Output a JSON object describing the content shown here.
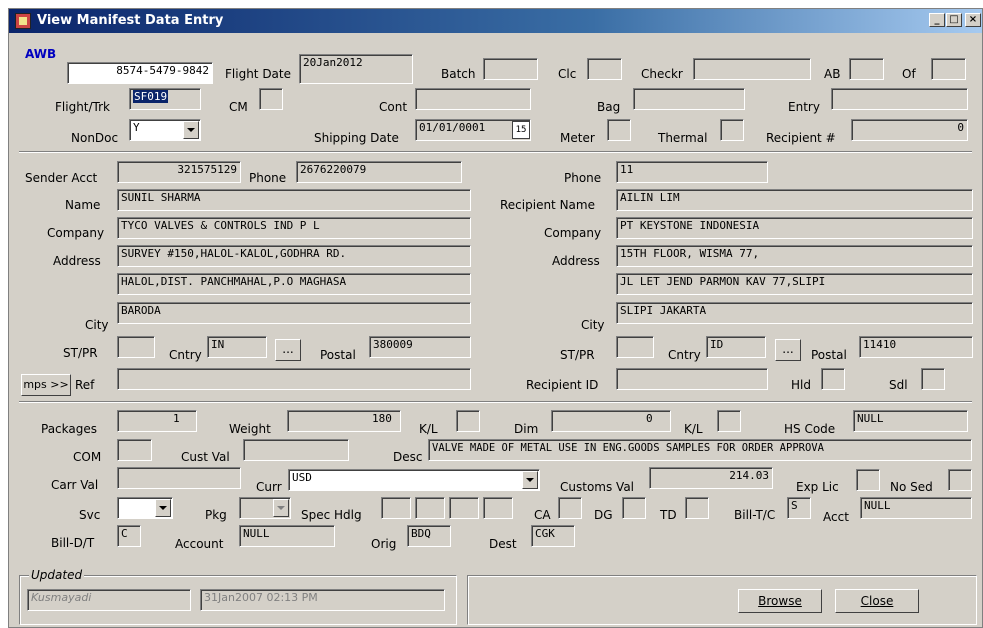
{
  "window": {
    "title": "View Manifest Data Entry",
    "minimize": "_",
    "maximize": "□",
    "close": "×"
  },
  "header": {
    "awb_label": "AWB",
    "awb_value": "8574-5479-9842",
    "flight_date_label": "Flight Date",
    "flight_date_value": "20Jan2012",
    "batch_label": "Batch",
    "batch_value": "",
    "clc_label": "Clc",
    "clc_value": "",
    "checkr_label": "Checkr",
    "checkr_value": "",
    "ab_label": "AB",
    "ab_value": "",
    "of_label": "Of",
    "of_value": "",
    "flight_trk_label": "Flight/Trk",
    "flight_trk_value": "SF019",
    "cm_label": "CM",
    "cm_value": "",
    "cont_label": "Cont",
    "cont_value": "",
    "bag_label": "Bag",
    "bag_value": "",
    "entry_label": "Entry",
    "entry_value": "",
    "nondoc_label": "NonDoc",
    "nondoc_value": "Y",
    "shipping_date_label": "Shipping Date",
    "shipping_date_value": "01/01/0001",
    "calendar_icon_text": "15",
    "meter_label": "Meter",
    "meter_value": "",
    "thermal_label": "Thermal",
    "thermal_value": "",
    "recipient_num_label": "Recipient #",
    "recipient_num_value": "0"
  },
  "sender": {
    "acct_label": "Sender Acct",
    "acct_value": "321575129",
    "phone_label": "Phone",
    "phone_value": "2676220079",
    "name_label": "Name",
    "name_value": "SUNIL SHARMA",
    "company_label": "Company",
    "company_value": "TYCO VALVES & CONTROLS IND P L",
    "address_label": "Address",
    "address1": "SURVEY #150,HALOL-KALOL,GODHRA RD.",
    "address2": "HALOL,DIST. PANCHMAHAL,P.O MAGHASA",
    "city_label": "City",
    "city_value": "BARODA",
    "stpr_label": "ST/PR",
    "stpr_value": "",
    "cntry_label": "Cntry",
    "cntry_value": "IN",
    "ellipsis": "...",
    "postal_label": "Postal",
    "postal_value": "380009",
    "mps_button": "mps >>",
    "ref_label": "Ref",
    "ref_value": ""
  },
  "recipient": {
    "phone_label": "Phone",
    "phone_value": "11",
    "name_label": "Recipient Name",
    "name_value": "AILIN LIM",
    "company_label": "Company",
    "company_value": "PT KEYSTONE INDONESIA",
    "address_label": "Address",
    "address1": "15TH FLOOR, WISMA 77,",
    "address2": "JL LET JEND PARMON KAV 77,SLIPI",
    "city_label": "City",
    "city_value": "SLIPI JAKARTA",
    "stpr_label": "ST/PR",
    "stpr_value": "",
    "cntry_label": "Cntry",
    "cntry_value": "ID",
    "ellipsis": "...",
    "postal_label": "Postal",
    "postal_value": "11410",
    "id_label": "Recipient ID",
    "id_value": "",
    "hld_label": "Hld",
    "hld_value": "",
    "sdl_label": "Sdl",
    "sdl_value": ""
  },
  "shipment": {
    "packages_label": "Packages",
    "packages_value": "1",
    "weight_label": "Weight",
    "weight_value": "180",
    "kl1_label": "K/L",
    "kl1_value": "",
    "dim_label": "Dim",
    "dim_value": "0",
    "kl2_label": "K/L",
    "kl2_value": "",
    "hs_code_label": "HS Code",
    "hs_code_value": "NULL",
    "com_label": "COM",
    "com_value": "",
    "cust_val_label": "Cust Val",
    "cust_val_value": "",
    "desc_label": "Desc",
    "desc_value": "VALVE MADE OF METAL USE IN ENG.GOODS SAMPLES FOR ORDER APPROVA",
    "carr_val_label": "Carr Val",
    "carr_val_value": "",
    "curr_label": "Curr",
    "curr_value": "USD",
    "customs_val_label": "Customs Val",
    "customs_val_value": "214.03",
    "exp_lic_label": "Exp Lic",
    "exp_lic_value": "",
    "no_sed_label": "No Sed",
    "no_sed_value": "",
    "svc_label": "Svc",
    "svc_value": "",
    "pkg_label": "Pkg",
    "pkg_value": "",
    "spec_hdlg_label": "Spec Hdlg",
    "ca_label": "CA",
    "dg_label": "DG",
    "td_label": "TD",
    "bill_tc_label": "Bill-T/C",
    "bill_tc_value": "S",
    "acct_label": "Acct",
    "acct_value": "NULL",
    "bill_dt_label": "Bill-D/T",
    "bill_dt_value": "C",
    "account_label": "Account",
    "account_value": "NULL",
    "orig_label": "Orig",
    "orig_value": "BDQ",
    "dest_label": "Dest",
    "dest_value": "CGK"
  },
  "footer": {
    "updated_label": "Updated",
    "updated_by": "Kusmayadi",
    "updated_at": "31Jan2007  02:13 PM",
    "browse_button": "Browse",
    "close_button": "Close"
  }
}
